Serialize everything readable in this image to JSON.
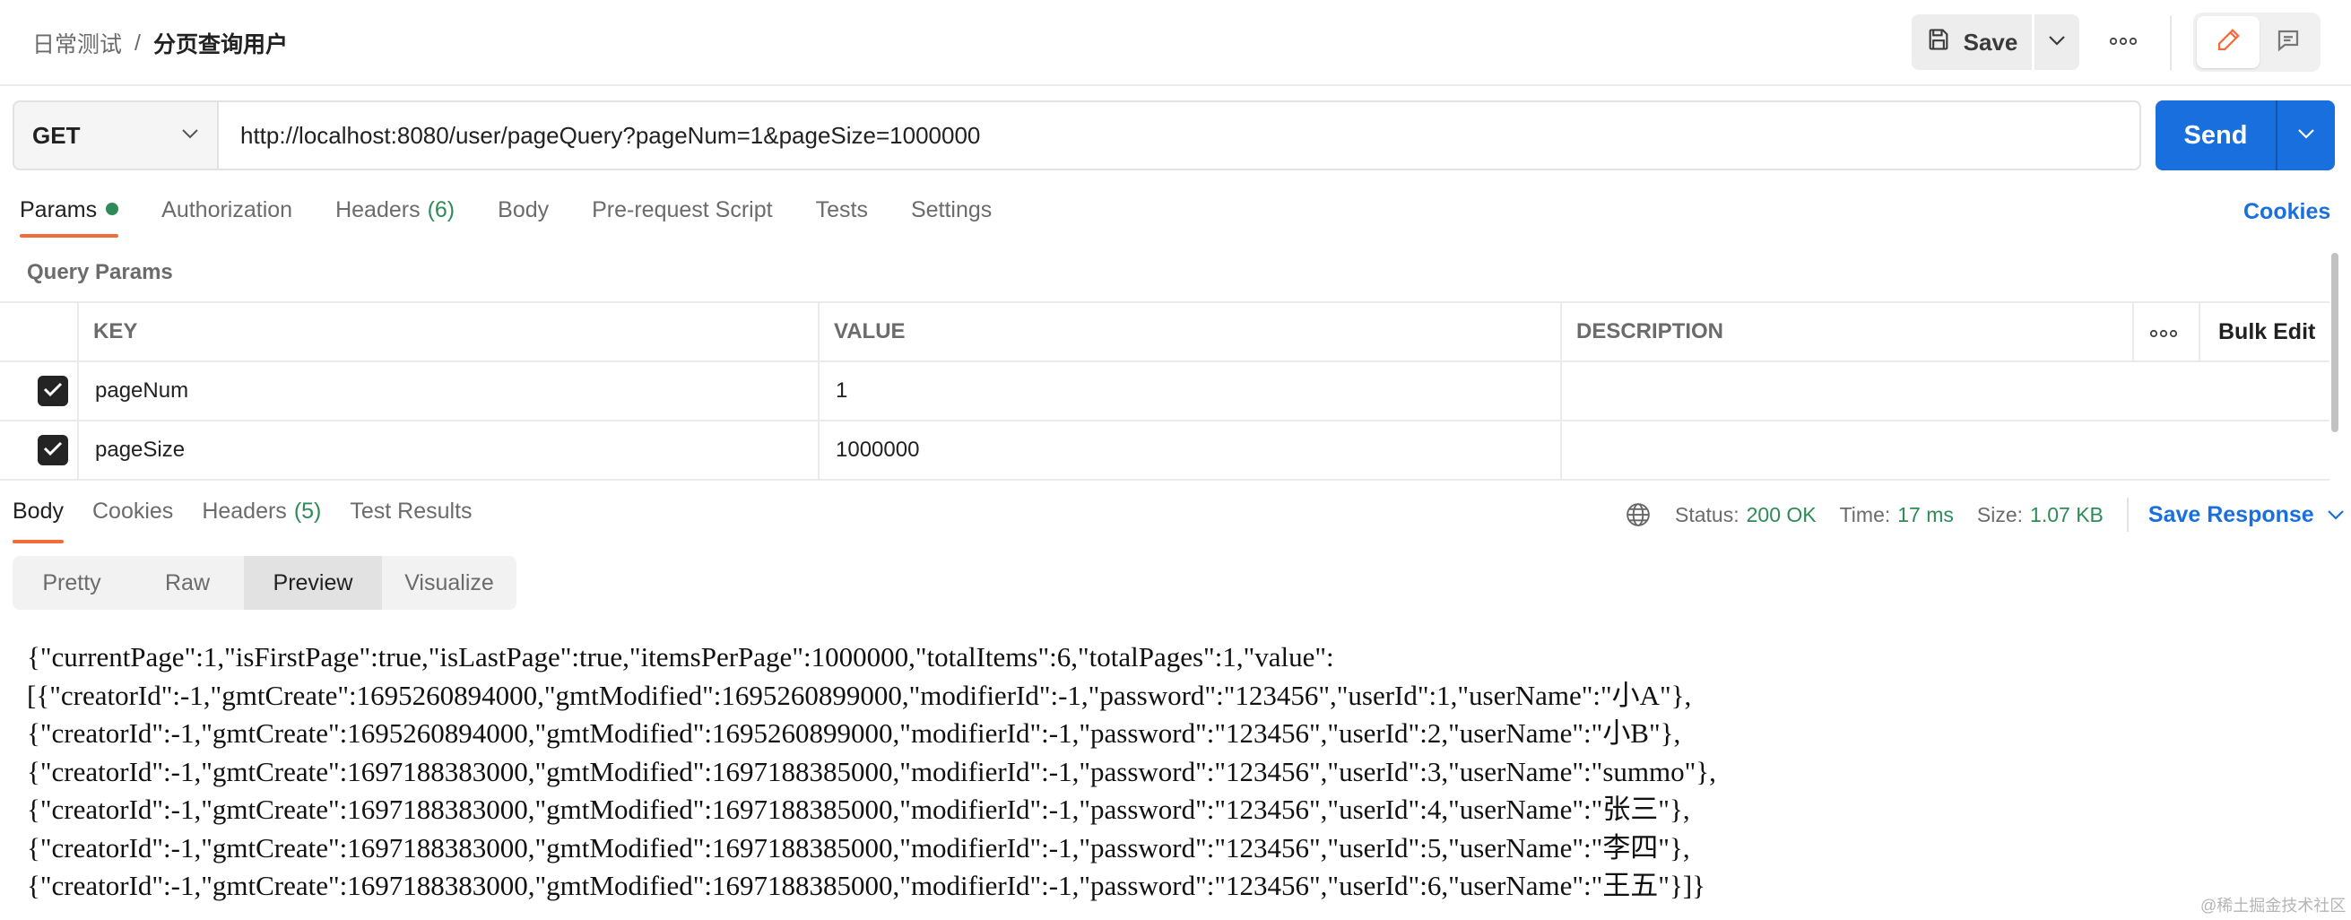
{
  "breadcrumb": {
    "parent": "日常测试",
    "separator": "/",
    "current": "分页查询用户"
  },
  "toolbar": {
    "save_label": "Save"
  },
  "request": {
    "method": "GET",
    "url": "http://localhost:8080/user/pageQuery?pageNum=1&pageSize=1000000",
    "send_label": "Send"
  },
  "request_tabs": [
    {
      "label": "Params",
      "count": ""
    },
    {
      "label": "Authorization",
      "count": ""
    },
    {
      "label": "Headers",
      "count": "(6)"
    },
    {
      "label": "Body",
      "count": ""
    },
    {
      "label": "Pre-request Script",
      "count": ""
    },
    {
      "label": "Tests",
      "count": ""
    },
    {
      "label": "Settings",
      "count": ""
    }
  ],
  "cookies_link": "Cookies",
  "query_params": {
    "title": "Query Params",
    "headers": {
      "key": "KEY",
      "value": "VALUE",
      "description": "DESCRIPTION",
      "bulk_edit": "Bulk Edit"
    },
    "rows": [
      {
        "key": "pageNum",
        "value": "1",
        "description": "",
        "checked": true
      },
      {
        "key": "pageSize",
        "value": "1000000",
        "description": "",
        "checked": true
      }
    ]
  },
  "response_tabs": [
    {
      "label": "Body",
      "count": ""
    },
    {
      "label": "Cookies",
      "count": ""
    },
    {
      "label": "Headers",
      "count": "(5)"
    },
    {
      "label": "Test Results",
      "count": ""
    }
  ],
  "response_meta": {
    "status_label": "Status:",
    "status_value": "200 OK",
    "time_label": "Time:",
    "time_value": "17 ms",
    "size_label": "Size:",
    "size_value": "1.07 KB",
    "save_response": "Save Response"
  },
  "format_tabs": [
    "Pretty",
    "Raw",
    "Preview",
    "Visualize"
  ],
  "preview_lines": [
    "{\"currentPage\":1,\"isFirstPage\":true,\"isLastPage\":true,\"itemsPerPage\":1000000,\"totalItems\":6,\"totalPages\":1,\"value\":",
    "[{\"creatorId\":-1,\"gmtCreate\":1695260894000,\"gmtModified\":1695260899000,\"modifierId\":-1,\"password\":\"123456\",\"userId\":1,\"userName\":\"小A\"},",
    "{\"creatorId\":-1,\"gmtCreate\":1695260894000,\"gmtModified\":1695260899000,\"modifierId\":-1,\"password\":\"123456\",\"userId\":2,\"userName\":\"小B\"},",
    "{\"creatorId\":-1,\"gmtCreate\":1697188383000,\"gmtModified\":1697188385000,\"modifierId\":-1,\"password\":\"123456\",\"userId\":3,\"userName\":\"summo\"},",
    "{\"creatorId\":-1,\"gmtCreate\":1697188383000,\"gmtModified\":1697188385000,\"modifierId\":-1,\"password\":\"123456\",\"userId\":4,\"userName\":\"张三\"},",
    "{\"creatorId\":-1,\"gmtCreate\":1697188383000,\"gmtModified\":1697188385000,\"modifierId\":-1,\"password\":\"123456\",\"userId\":5,\"userName\":\"李四\"},",
    "{\"creatorId\":-1,\"gmtCreate\":1697188383000,\"gmtModified\":1697188385000,\"modifierId\":-1,\"password\":\"123456\",\"userId\":6,\"userName\":\"王五\"}]}"
  ],
  "watermark": "@稀土掘金技术社区",
  "colors": {
    "accent": "#1a6fde",
    "tab_underline": "#f26b3a",
    "success": "#2e8b57"
  },
  "icons": {
    "save": "floppy-disk-icon",
    "caret": "chevron-down-icon",
    "more": "ellipsis-icon",
    "edit": "pencil-icon",
    "docs": "comment-icon",
    "globe": "globe-icon",
    "check": "checkmark-icon"
  }
}
